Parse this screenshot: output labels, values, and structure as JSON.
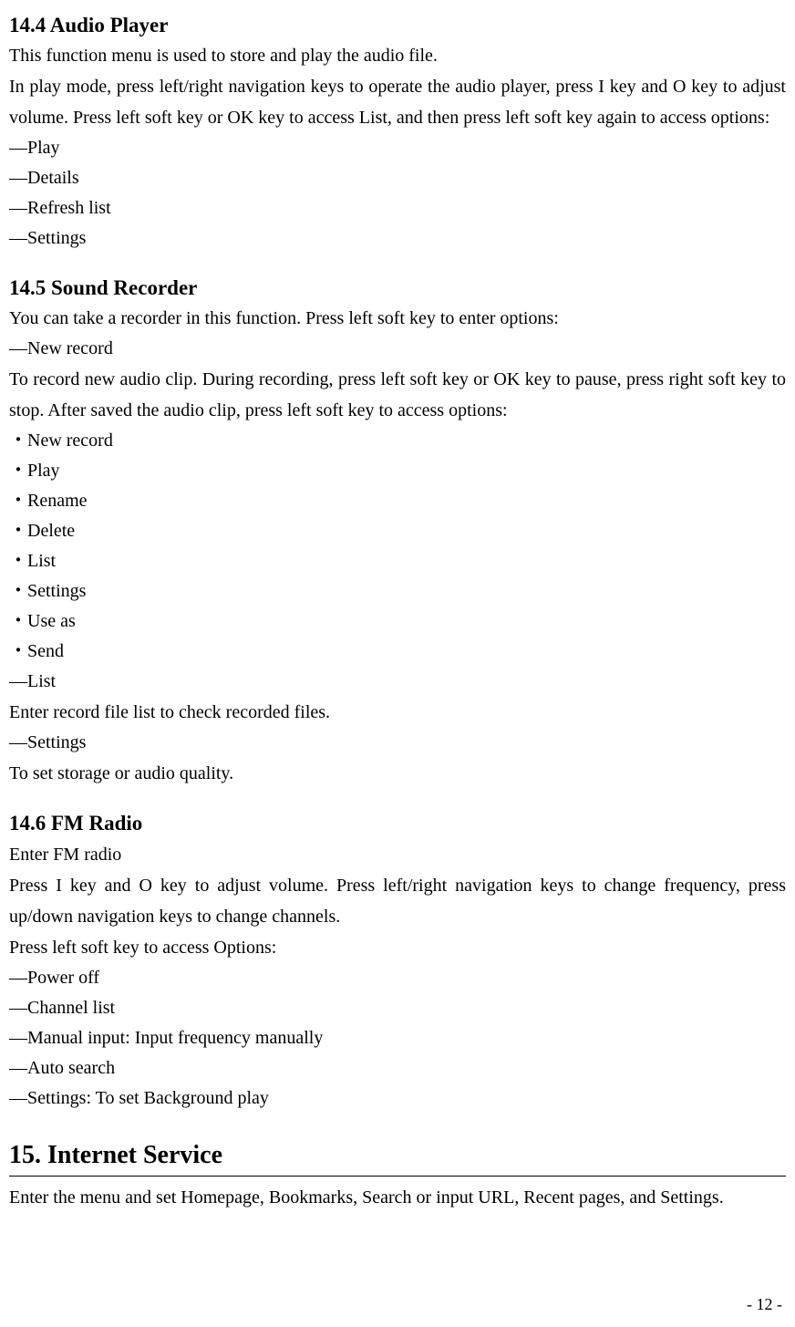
{
  "s14_4": {
    "heading": "14.4 Audio Player",
    "p1": "This function menu is used to store and play the audio file.",
    "p2": "In play mode, press left/right navigation keys to operate the audio player, press I key and O key to adjust volume. Press left soft key or OK key to access List, and then press left soft key again to access options:",
    "items": [
      "Play",
      "Details",
      "Refresh list",
      "Settings"
    ]
  },
  "s14_5": {
    "heading": "14.5 Sound Recorder",
    "p1": "You can take a recorder in this function. Press left soft key to enter options:",
    "item_new_record": "New record",
    "p2": "To record new audio clip. During recording, press left soft key or OK key to pause, press right soft key to stop. After saved the audio clip, press left soft key to access options:",
    "dot_items": [
      "New record",
      "Play",
      "Rename",
      "Delete",
      "List",
      "Settings",
      "Use as",
      "Send"
    ],
    "item_list": "List",
    "p3": "Enter record file list to check recorded files.",
    "item_settings": "Settings",
    "p4": "To set storage or audio quality."
  },
  "s14_6": {
    "heading": "14.6 FM Radio",
    "p1": "Enter FM radio",
    "p2": "Press I key and O key to adjust volume. Press left/right navigation keys to change frequency, press up/down navigation keys to change channels.",
    "p3": "Press left soft key to access Options:",
    "items": [
      "Power off",
      "Channel list",
      "Manual input: Input frequency manually",
      "Auto search",
      "Settings: To set Background play"
    ]
  },
  "s15": {
    "heading": "15. Internet Service",
    "p1": "Enter the menu and set Homepage, Bookmarks, Search or input URL, Recent pages, and Settings."
  },
  "page_number": "- 12 -"
}
